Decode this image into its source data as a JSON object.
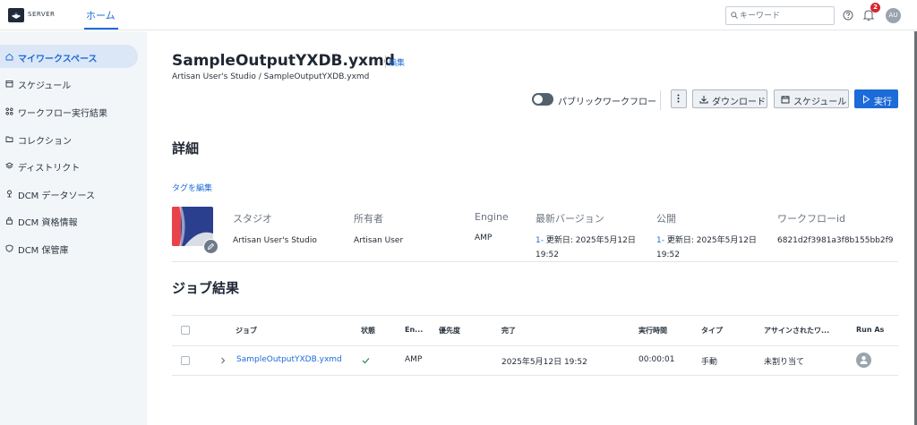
{
  "topbar": {
    "logo_text": "SERVER",
    "nav_home": "ホーム",
    "search_placeholder": "キーワード",
    "notification_count": "2",
    "avatar_initials": "AU"
  },
  "sidebar": {
    "items": [
      {
        "label": "マイワークスペース",
        "icon": "home-icon"
      },
      {
        "label": "スケジュール",
        "icon": "calendar-icon"
      },
      {
        "label": "ワークフロー実行結果",
        "icon": "workflow-results-icon"
      },
      {
        "label": "コレクション",
        "icon": "folder-icon"
      },
      {
        "label": "ディストリクト",
        "icon": "layers-icon"
      },
      {
        "label": "DCM データソース",
        "icon": "datasource-icon"
      },
      {
        "label": "DCM 資格情報",
        "icon": "lock-icon"
      },
      {
        "label": "DCM 保管庫",
        "icon": "shield-icon"
      }
    ],
    "active_index": 0
  },
  "workflow": {
    "title": "SampleOutputYXDB.yxmd",
    "edit_label": "編集",
    "breadcrumb": "Artisan User's Studio / SampleOutputYXDB.yxmd"
  },
  "toolbar": {
    "public_toggle_label": "パブリックワークフロー",
    "public_on": false,
    "download_label": "ダウンロード",
    "schedule_label": "スケジュール",
    "run_label": "実行"
  },
  "details": {
    "heading": "詳細",
    "tag_edit": "タグを編集",
    "fields": {
      "studio": {
        "label": "スタジオ",
        "value": "Artisan User's Studio"
      },
      "owner": {
        "label": "所有者",
        "value": "Artisan User"
      },
      "engine": {
        "label": "Engine",
        "value": "AMP"
      },
      "latest_version": {
        "label": "最新バージョン",
        "version": "1-",
        "value": "更新日: 2025年5月12日",
        "time": "19:52"
      },
      "published": {
        "label": "公開",
        "version": "1-",
        "value": "更新日: 2025年5月12日",
        "time": "19:52"
      },
      "workflow_id": {
        "label": "ワークフローid",
        "value": "6821d2f3981a3f8b155bb2f9"
      }
    }
  },
  "jobs": {
    "heading": "ジョブ結果",
    "columns": [
      "ジョブ",
      "状態",
      "En...",
      "優先度",
      "完了",
      "実行時間",
      "タイプ",
      "アサインされたワ...",
      "Run As"
    ],
    "rows": [
      {
        "job": "SampleOutputYXDB.yxmd",
        "status": "success",
        "engine": "AMP",
        "priority": "",
        "completed": "2025年5月12日 19:52",
        "duration": "00:00:01",
        "type": "手動",
        "assigned": "未割り当て"
      }
    ]
  },
  "colors": {
    "accent": "#1c6bd8",
    "sidebar_bg": "#f3f6f9",
    "sidebar_active": "#dbe7f6",
    "badge": "#d8262d"
  }
}
